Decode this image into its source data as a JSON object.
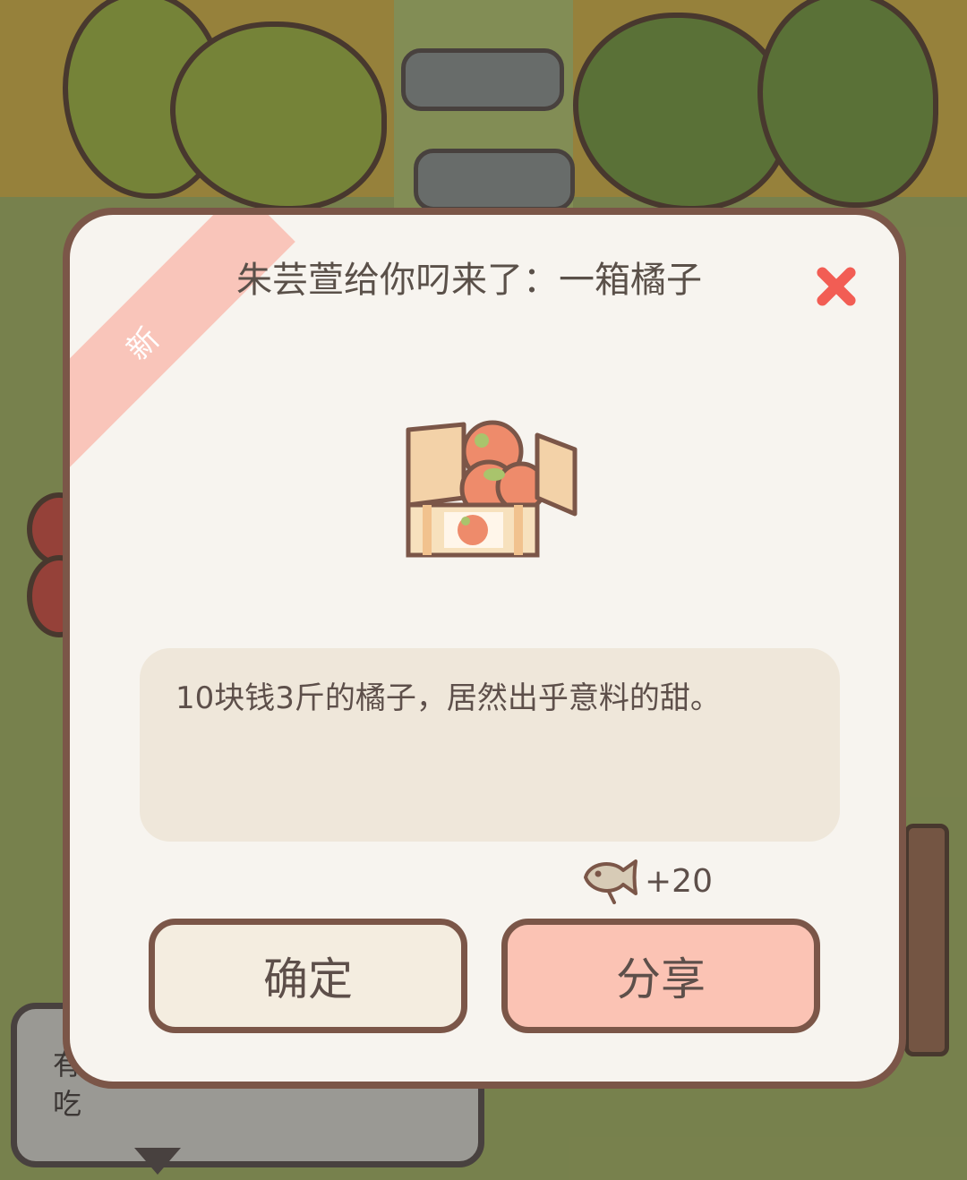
{
  "dialog": {
    "badge": "新",
    "title": "朱芸萱给你叼来了：一箱橘子",
    "item_name": "一箱橘子",
    "message": "10块钱3斤的橘子，居然出乎意料的甜。",
    "reward": {
      "icon": "fish-icon",
      "amount": "+20"
    },
    "buttons": {
      "confirm": "确定",
      "share": "分享"
    }
  },
  "background": {
    "speech_bubble": "有好吃"
  },
  "colors": {
    "dialog_bg": "#f7f4ef",
    "border": "#7b5648",
    "ribbon": "#f9c5ba",
    "close": "#f25d54",
    "confirm_bg": "#f4ede0",
    "share_bg": "#fbc3b4"
  }
}
